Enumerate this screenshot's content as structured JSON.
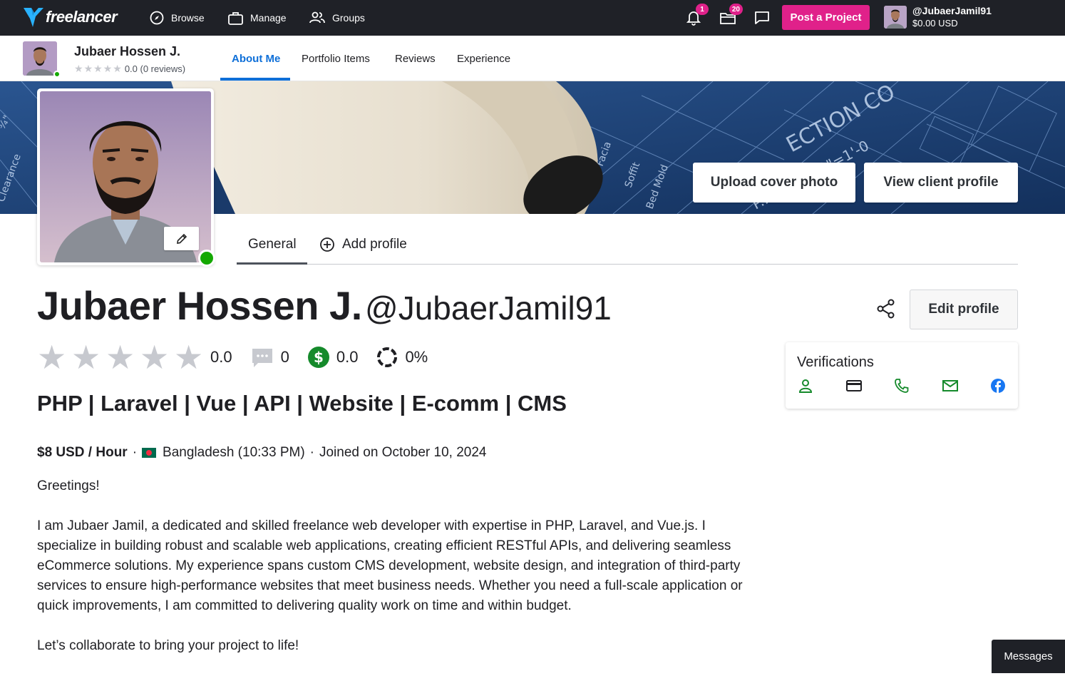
{
  "topbar": {
    "logo_text": "freelancer",
    "nav": [
      {
        "label": "Browse",
        "icon": "compass-icon"
      },
      {
        "label": "Manage",
        "icon": "briefcase-icon"
      },
      {
        "label": "Groups",
        "icon": "groups-icon"
      }
    ],
    "notifications_count": "1",
    "projects_count": "20",
    "post_project_label": "Post a Project",
    "account_username": "@JubaerJamil91",
    "account_balance": "$0.00 USD"
  },
  "subbar": {
    "name": "Jubaer Hossen J.",
    "rating_text": "0.0 (0 reviews)",
    "tabs": [
      "About Me",
      "Portfolio Items",
      "Reviews",
      "Experience"
    ],
    "active_tab": "About Me"
  },
  "cover": {
    "upload_label": "Upload cover photo",
    "view_client_label": "View client profile"
  },
  "profile_tabs": {
    "general": "General",
    "add_profile": "Add profile"
  },
  "profile": {
    "full_name": "Jubaer Hossen J.",
    "username": "@JubaerJamil91",
    "edit_profile_label": "Edit profile",
    "rating": "0.0",
    "rating_stars": 0,
    "reviews_count": "0",
    "earnings_score": "0.0",
    "completion_rate": "0%",
    "tagline": "PHP | Laravel | Vue | API | Website | E-comm | CMS",
    "rate": "$8 USD / Hour",
    "location": "Bangladesh (10:33 PM)",
    "joined": "Joined on October 10, 2024",
    "bio": [
      "Greetings!",
      "I am Jubaer Jamil, a dedicated and skilled freelance web developer with expertise in PHP, Laravel, and Vue.js. I specialize in building robust and scalable web applications, creating efficient RESTful APIs, and delivering seamless eCommerce solutions. My experience spans custom CMS development, website design, and integration of third-party services to ensure high-performance websites that meet business needs. Whether you need a full-scale application or quick improvements, I am committed to delivering quality work on time and within budget.",
      "Let’s collaborate to bring your project to life!"
    ]
  },
  "verifications": {
    "title": "Verifications",
    "items": [
      "identity-icon",
      "payment-card-icon",
      "phone-icon",
      "email-icon",
      "facebook-icon"
    ]
  },
  "messages_label": "Messages",
  "colors": {
    "brand_pink": "#e0218a",
    "link_blue": "#0e6fd8",
    "online_green": "#14a800",
    "verified_green": "#14a800",
    "facebook_blue": "#1877f2",
    "topbar_bg": "#1f2127"
  }
}
